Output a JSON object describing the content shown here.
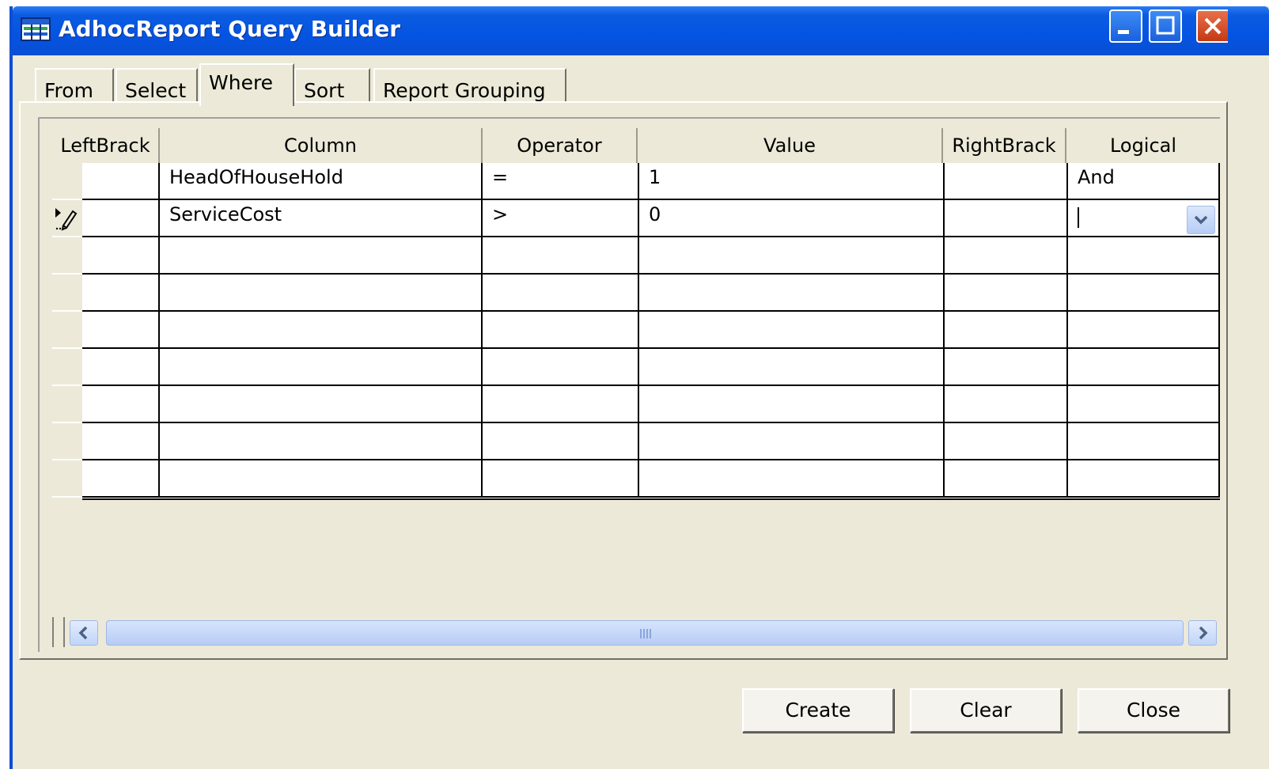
{
  "window": {
    "title": "AdhocReport Query Builder"
  },
  "tabs": [
    {
      "label": "From"
    },
    {
      "label": "Select"
    },
    {
      "label": "Where"
    },
    {
      "label": "Sort"
    },
    {
      "label": "Report Grouping"
    }
  ],
  "active_tab": "Where",
  "grid": {
    "columns": [
      "LeftBrack",
      "Column",
      "Operator",
      "Value",
      "RightBrack",
      "Logical"
    ],
    "rows": [
      {
        "leftbrack": "",
        "column": "HeadOfHouseHold",
        "operator": "=",
        "value": "1",
        "rightbrack": "",
        "logical": "And"
      },
      {
        "leftbrack": "",
        "column": "ServiceCost",
        "operator": ">",
        "value": "0",
        "rightbrack": "",
        "logical": ""
      }
    ],
    "empty_rows": 7
  },
  "buttons": {
    "create": "Create",
    "clear": "Clear",
    "close": "Close"
  },
  "icons": {
    "app": "grid-table-icon",
    "row_edit": "pencil-edit-icon",
    "dropdown": "chevron-down-icon",
    "scroll_left": "chevron-left-icon",
    "scroll_right": "chevron-right-icon"
  },
  "colors": {
    "titlebar": "#0454e3",
    "window_bg": "#ece9d8",
    "close_button": "#c33a14",
    "scrollbar": "#c1d5f8"
  }
}
